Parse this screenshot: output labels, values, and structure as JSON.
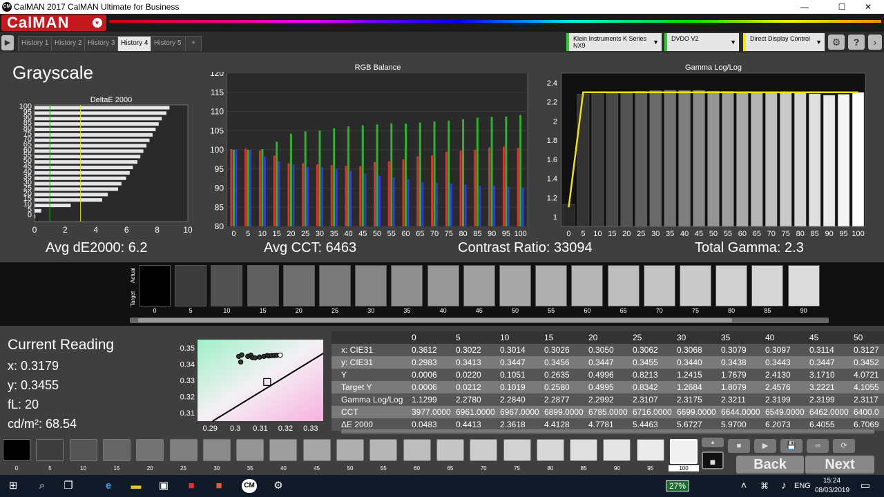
{
  "window": {
    "title": "CalMAN 2017 CalMAN Ultimate for Business",
    "min": "—",
    "max": "☐",
    "close": "✕",
    "icon_text": "CM"
  },
  "brand": {
    "logo": "CalMAN",
    "dropdown": "▾"
  },
  "tabs": [
    {
      "label": "History 1"
    },
    {
      "label": "History 2"
    },
    {
      "label": "History 3"
    },
    {
      "label": "History 4",
      "active": true
    },
    {
      "label": "History 5"
    },
    {
      "label": "+"
    }
  ],
  "devices": [
    {
      "line1": "Klein Instruments K Series",
      "line2": "NX9",
      "color": "#33cc33"
    },
    {
      "line1": "DVDO V2",
      "line2": "",
      "color": "#33cc33"
    },
    {
      "line1": "Direct Display Control",
      "line2": "",
      "color": "#eeee00"
    }
  ],
  "icons": {
    "settings": "⚙",
    "help": "?",
    "next": "›",
    "play": "▶"
  },
  "page": {
    "title": "Grayscale"
  },
  "stats": {
    "avg_de": "Avg dE2000: 6.2",
    "avg_cct": "Avg CCT: 6463",
    "contrast": "Contrast Ratio: 33094",
    "gamma": "Total Gamma: 2.3"
  },
  "swatch_strip": {
    "actual_label": "Actual",
    "target_label": "Target",
    "labels": [
      "0",
      "5",
      "10",
      "15",
      "20",
      "25",
      "30",
      "35",
      "40",
      "45",
      "50",
      "55",
      "60",
      "65",
      "70",
      "75",
      "80",
      "85",
      "90"
    ]
  },
  "current_reading": {
    "title": "Current Reading",
    "x": "x: 0.3179",
    "y": "y: 0.3455",
    "fl": "fL: 20",
    "cdm2": "cd/m²: 68.54"
  },
  "table": {
    "headers": [
      "0",
      "5",
      "10",
      "15",
      "20",
      "25",
      "30",
      "35",
      "40",
      "45",
      "50"
    ],
    "rows": [
      {
        "label": "x: CIE31",
        "values": [
          "0.3612",
          "0.3022",
          "0.3014",
          "0.3026",
          "0.3050",
          "0.3062",
          "0.3068",
          "0.3079",
          "0.3097",
          "0.3114",
          "0.3127"
        ]
      },
      {
        "label": "y: CIE31",
        "values": [
          "0.2983",
          "0.3413",
          "0.3447",
          "0.3456",
          "0.3447",
          "0.3455",
          "0.3440",
          "0.3438",
          "0.3443",
          "0.3447",
          "0.3452"
        ]
      },
      {
        "label": "Y",
        "values": [
          "0.0006",
          "0.0220",
          "0.1051",
          "0.2635",
          "0.4996",
          "0.8213",
          "1.2415",
          "1.7679",
          "2.4130",
          "3.1710",
          "4.0721"
        ]
      },
      {
        "label": "Target Y",
        "values": [
          "0.0006",
          "0.0212",
          "0.1019",
          "0.2580",
          "0.4995",
          "0.8342",
          "1.2684",
          "1.8079",
          "2.4576",
          "3.2221",
          "4.1055"
        ]
      },
      {
        "label": "Gamma Log/Log",
        "values": [
          "1.1299",
          "2.2780",
          "2.2840",
          "2.2877",
          "2.2992",
          "2.3107",
          "2.3175",
          "2.3211",
          "2.3199",
          "2.3199",
          "2.3117"
        ]
      },
      {
        "label": "CCT",
        "values": [
          "3977.0000",
          "6961.0000",
          "6967.0000",
          "6899.0000",
          "6785.0000",
          "6716.0000",
          "6699.0000",
          "6644.0000",
          "6549.0000",
          "6462.0000",
          "6400.0"
        ]
      },
      {
        "label": "ΔE 2000",
        "values": [
          "0.0483",
          "0.4413",
          "2.3618",
          "4.4128",
          "4.7781",
          "5.4463",
          "5.6727",
          "5.9700",
          "6.2073",
          "6.4055",
          "6.7069"
        ]
      }
    ]
  },
  "bottom_swatches": [
    "0",
    "5",
    "10",
    "15",
    "20",
    "25",
    "30",
    "35",
    "40",
    "45",
    "50",
    "55",
    "60",
    "65",
    "70",
    "75",
    "80",
    "85",
    "90",
    "95",
    "100"
  ],
  "nav": {
    "back": "Back",
    "next": "Next"
  },
  "controls": {
    "stop": "■",
    "play": "▶",
    "save": "💾",
    "loop": "∞",
    "refresh": "⟳",
    "up": "▲",
    "down": "▼"
  },
  "taskbar": {
    "battery": "27%",
    "lang": "ENG",
    "time": "15:24",
    "date": "08/03/2019",
    "start": "⊞",
    "search": "⌕",
    "taskview": "❐",
    "edge": "e",
    "folder": "▬",
    "store": "▣",
    "app_cm": "CM",
    "gear": "⚙",
    "up_chevron": "˄",
    "speaker": "♪",
    "network": "⌘",
    "notif": "▭"
  },
  "chart_data": [
    {
      "type": "bar",
      "title": "DeltaE 2000",
      "orientation": "horizontal",
      "categories": [
        "0",
        "5",
        "10",
        "15",
        "20",
        "25",
        "30",
        "35",
        "40",
        "45",
        "50",
        "55",
        "60",
        "65",
        "70",
        "75",
        "80",
        "85",
        "90",
        "95",
        "100"
      ],
      "values": [
        0.05,
        0.44,
        2.36,
        4.41,
        4.78,
        5.45,
        5.67,
        5.97,
        6.21,
        6.41,
        6.71,
        6.9,
        7.1,
        7.3,
        7.5,
        7.7,
        7.9,
        8.1,
        8.3,
        8.6,
        8.8
      ],
      "xlim": [
        0,
        10
      ],
      "xticks": [
        "0",
        "2",
        "4",
        "6",
        "8",
        "10"
      ],
      "yticks": [
        "0",
        "5",
        "10",
        "15",
        "20",
        "25",
        "30",
        "35",
        "40",
        "45",
        "50",
        "55",
        "60",
        "65",
        "70",
        "75",
        "80",
        "85",
        "90",
        "95",
        "100"
      ],
      "reference_lines": [
        {
          "x": 1,
          "color": "#22aa22"
        },
        {
          "x": 3,
          "color": "#dddd22"
        }
      ]
    },
    {
      "type": "bar",
      "title": "RGB Balance",
      "categories": [
        "0",
        "5",
        "10",
        "15",
        "20",
        "25",
        "30",
        "35",
        "40",
        "45",
        "50",
        "55",
        "60",
        "65",
        "70",
        "75",
        "80",
        "85",
        "90",
        "95",
        "100"
      ],
      "series": [
        {
          "name": "Red",
          "color": "#e03030",
          "values": [
            100.2,
            100.3,
            99.8,
            98.5,
            96.5,
            96.5,
            96.2,
            96.0,
            95.8,
            95.8,
            96.8,
            97.0,
            97.5,
            98.3,
            98.5,
            99.5,
            99.8,
            100.0,
            100.6,
            100.8,
            100.5
          ]
        },
        {
          "name": "Green",
          "color": "#30b030",
          "values": [
            100.0,
            100.0,
            100.2,
            102.1,
            104.2,
            104.8,
            105.0,
            105.6,
            106.1,
            106.4,
            106.6,
            106.9,
            106.8,
            107.1,
            107.4,
            107.6,
            108.0,
            108.4,
            108.6,
            108.7,
            109.1
          ]
        },
        {
          "name": "Blue",
          "color": "#3838e0",
          "values": [
            100.1,
            100.0,
            98.2,
            97.0,
            96.2,
            95.5,
            95.5,
            95.0,
            94.5,
            93.8,
            93.2,
            92.8,
            92.3,
            91.5,
            91.4,
            91.2,
            90.9,
            90.6,
            90.7,
            90.3,
            90.2
          ]
        }
      ],
      "ylim": [
        80,
        120
      ],
      "yticks": [
        "80",
        "85",
        "90",
        "95",
        "100",
        "105",
        "110",
        "115",
        "120"
      ]
    },
    {
      "type": "bar",
      "title": "Gamma Log/Log",
      "categories": [
        "0",
        "5",
        "10",
        "15",
        "20",
        "25",
        "30",
        "35",
        "40",
        "45",
        "50",
        "55",
        "60",
        "65",
        "70",
        "75",
        "80",
        "85",
        "90",
        "95",
        "100"
      ],
      "values": [
        1.13,
        2.28,
        2.284,
        2.288,
        2.299,
        2.311,
        2.318,
        2.321,
        2.32,
        2.32,
        2.312,
        2.31,
        2.305,
        2.3,
        2.3,
        2.3,
        2.295,
        2.285,
        2.27,
        2.28,
        2.3
      ],
      "target_line": [
        1.1,
        2.3,
        2.3,
        2.3,
        2.3,
        2.3,
        2.3,
        2.3,
        2.3,
        2.3,
        2.3,
        2.3,
        2.3,
        2.3,
        2.3,
        2.3,
        2.3,
        2.3,
        2.3,
        2.3,
        2.3
      ],
      "ylim": [
        0.9,
        2.5
      ],
      "yticks": [
        "1",
        "1.2",
        "1.4",
        "1.6",
        "1.8",
        "2",
        "2.2",
        "2.4"
      ]
    },
    {
      "type": "scatter",
      "title": "",
      "x": [
        0.3022,
        0.3014,
        0.3026,
        0.305,
        0.3062,
        0.3068,
        0.3079,
        0.3097,
        0.3114,
        0.3127,
        0.3135,
        0.3145,
        0.3155,
        0.3165,
        0.3179
      ],
      "y": [
        0.3413,
        0.3447,
        0.3456,
        0.3447,
        0.3455,
        0.344,
        0.3438,
        0.3443,
        0.3447,
        0.3452,
        0.345,
        0.3452,
        0.3453,
        0.3454,
        0.3455
      ],
      "target": {
        "x": 0.3127,
        "y": 0.329
      },
      "xlim": [
        0.285,
        0.335
      ],
      "ylim": [
        0.305,
        0.355
      ],
      "xticks": [
        "0.29",
        "0.3",
        "0.31",
        "0.32",
        "0.33"
      ],
      "yticks": [
        "0.31",
        "0.32",
        "0.33",
        "0.34",
        "0.35"
      ]
    }
  ]
}
